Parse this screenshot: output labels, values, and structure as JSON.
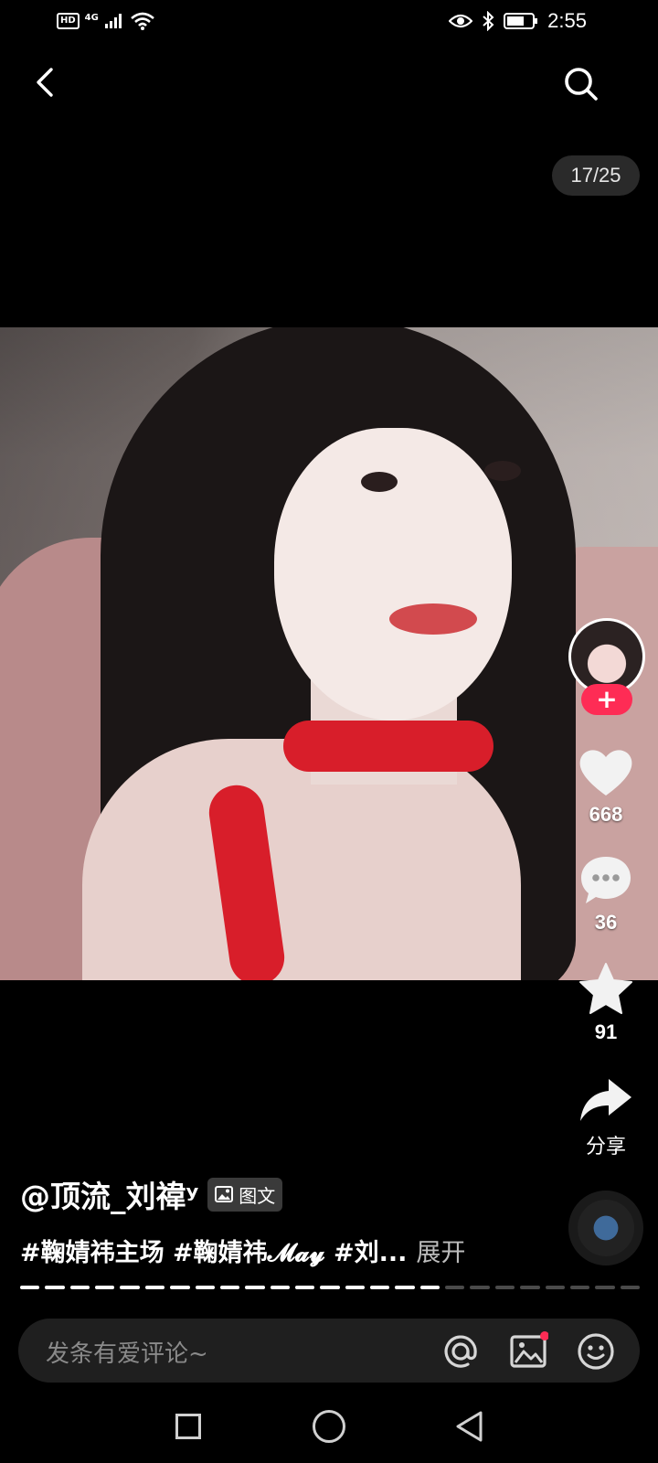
{
  "status_bar": {
    "network": "4G",
    "badge": "HD",
    "time": "2:55"
  },
  "page_counter": "17/25",
  "author": {
    "handle": "@顶流_刘禕ʸ",
    "post_type": "图文"
  },
  "caption": {
    "tags_text": "#鞠婧祎主场 #鞠婧祎𝓜𝓪𝔂 #刘...",
    "expand_label": "展开"
  },
  "actions": {
    "follow_label": "+",
    "likes": "668",
    "comments": "36",
    "collects": "91",
    "share_label": "分享"
  },
  "gallery": {
    "current_page": 17,
    "total_pages": 25
  },
  "comment_bar": {
    "placeholder": "发条有爱评论~"
  },
  "colors": {
    "accent": "#fe2c55",
    "background": "#000000",
    "progress_active": "#ffffff",
    "progress_inactive": "#4a4a4a"
  },
  "icons": {
    "back": "chevron-left-icon",
    "search": "search-icon",
    "like": "heart-icon",
    "comment": "chat-bubble-icon",
    "collect": "star-icon",
    "share": "share-arrow-icon",
    "mention": "at-icon",
    "image": "image-icon",
    "emoji": "emoji-icon"
  }
}
